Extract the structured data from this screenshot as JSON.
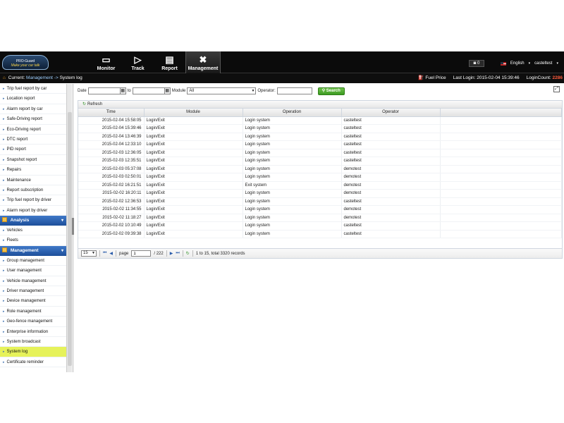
{
  "header": {
    "logo_line1": "PRO-Guard",
    "logo_line2": "Make your car talk",
    "nav": [
      {
        "label": "Monitor",
        "icon": "monitor-icon"
      },
      {
        "label": "Track",
        "icon": "play-icon"
      },
      {
        "label": "Report",
        "icon": "report-icon"
      },
      {
        "label": "Management",
        "icon": "tools-icon"
      }
    ],
    "active_nav": "Management",
    "camera_count": "0",
    "language": "English",
    "user": "casteltest"
  },
  "breadcrumb": {
    "prefix": "Current:",
    "section": "Management",
    "separator": "->",
    "page": "System log",
    "fuel_price": "Fuel Price",
    "last_login_label": "Last Login:",
    "last_login": "2015-02-04 15:39:46",
    "login_count_label": "LoginCount:",
    "login_count": "2286"
  },
  "sidebar": {
    "report_items": [
      "Trip fuel report by car",
      "Location report",
      "Alarm report by car",
      "Safe-Driving report",
      "Eco-Driving report",
      "DTC report",
      "PID report",
      "Snapshot report",
      "Repairs",
      "Maintenance",
      "Report subscription",
      "Trip fuel report by driver",
      "Alarm report by driver"
    ],
    "analysis": {
      "title": "Analysis",
      "items": [
        "Vehicles",
        "Fleets"
      ]
    },
    "management": {
      "title": "Management",
      "items": [
        "Group management",
        "User management",
        "Vehicle management",
        "Driver management",
        "Device management",
        "Role management",
        "Geo-fence management",
        "Enterprise information",
        "System broadcast",
        "System log",
        "Certificate reminder"
      ]
    },
    "selected": "System log"
  },
  "filter": {
    "date_label": "Date",
    "date_from": "",
    "to_label": "to",
    "date_to": "",
    "module_label": "Module",
    "module_value": "All",
    "operator_label": "Operator:",
    "operator_value": "",
    "search_label": "Search"
  },
  "grid": {
    "refresh_label": "Refresh",
    "columns": [
      "Time",
      "Module",
      "Operation",
      "Operator"
    ],
    "rows": [
      [
        "2015-02-04 15:58:05",
        "Login/Exit",
        "Login system",
        "casteltest"
      ],
      [
        "2015-02-04 15:39:46",
        "Login/Exit",
        "Login system",
        "casteltest"
      ],
      [
        "2015-02-04 13:46:39",
        "Login/Exit",
        "Login system",
        "casteltest"
      ],
      [
        "2015-02-04 12:33:10",
        "Login/Exit",
        "Login system",
        "casteltest"
      ],
      [
        "2015-02-03 12:36:05",
        "Login/Exit",
        "Login system",
        "casteltest"
      ],
      [
        "2015-02-03 12:35:51",
        "Login/Exit",
        "Login system",
        "casteltest"
      ],
      [
        "2015-02-03 05:37:08",
        "Login/Exit",
        "Login system",
        "demotest"
      ],
      [
        "2015-02-03 02:50:01",
        "Login/Exit",
        "Login system",
        "demotest"
      ],
      [
        "2015-02-02 16:21:51",
        "Login/Exit",
        "Exit system",
        "demotest"
      ],
      [
        "2015-02-02 16:20:11",
        "Login/Exit",
        "Login system",
        "demotest"
      ],
      [
        "2015-02-02 12:36:53",
        "Login/Exit",
        "Login system",
        "casteltest"
      ],
      [
        "2015-02-02 11:34:55",
        "Login/Exit",
        "Login system",
        "demotest"
      ],
      [
        "2015-02-02 11:18:27",
        "Login/Exit",
        "Login system",
        "demotest"
      ],
      [
        "2015-02-02 10:10:49",
        "Login/Exit",
        "Login system",
        "casteltest"
      ],
      [
        "2015-02-02 09:39:38",
        "Login/Exit",
        "Login system",
        "casteltest"
      ]
    ],
    "pager": {
      "page_size": "15",
      "page_label": "page",
      "page_value": "1",
      "total_pages": "/ 222",
      "summary": "1 to 15, total 3320 records"
    }
  }
}
